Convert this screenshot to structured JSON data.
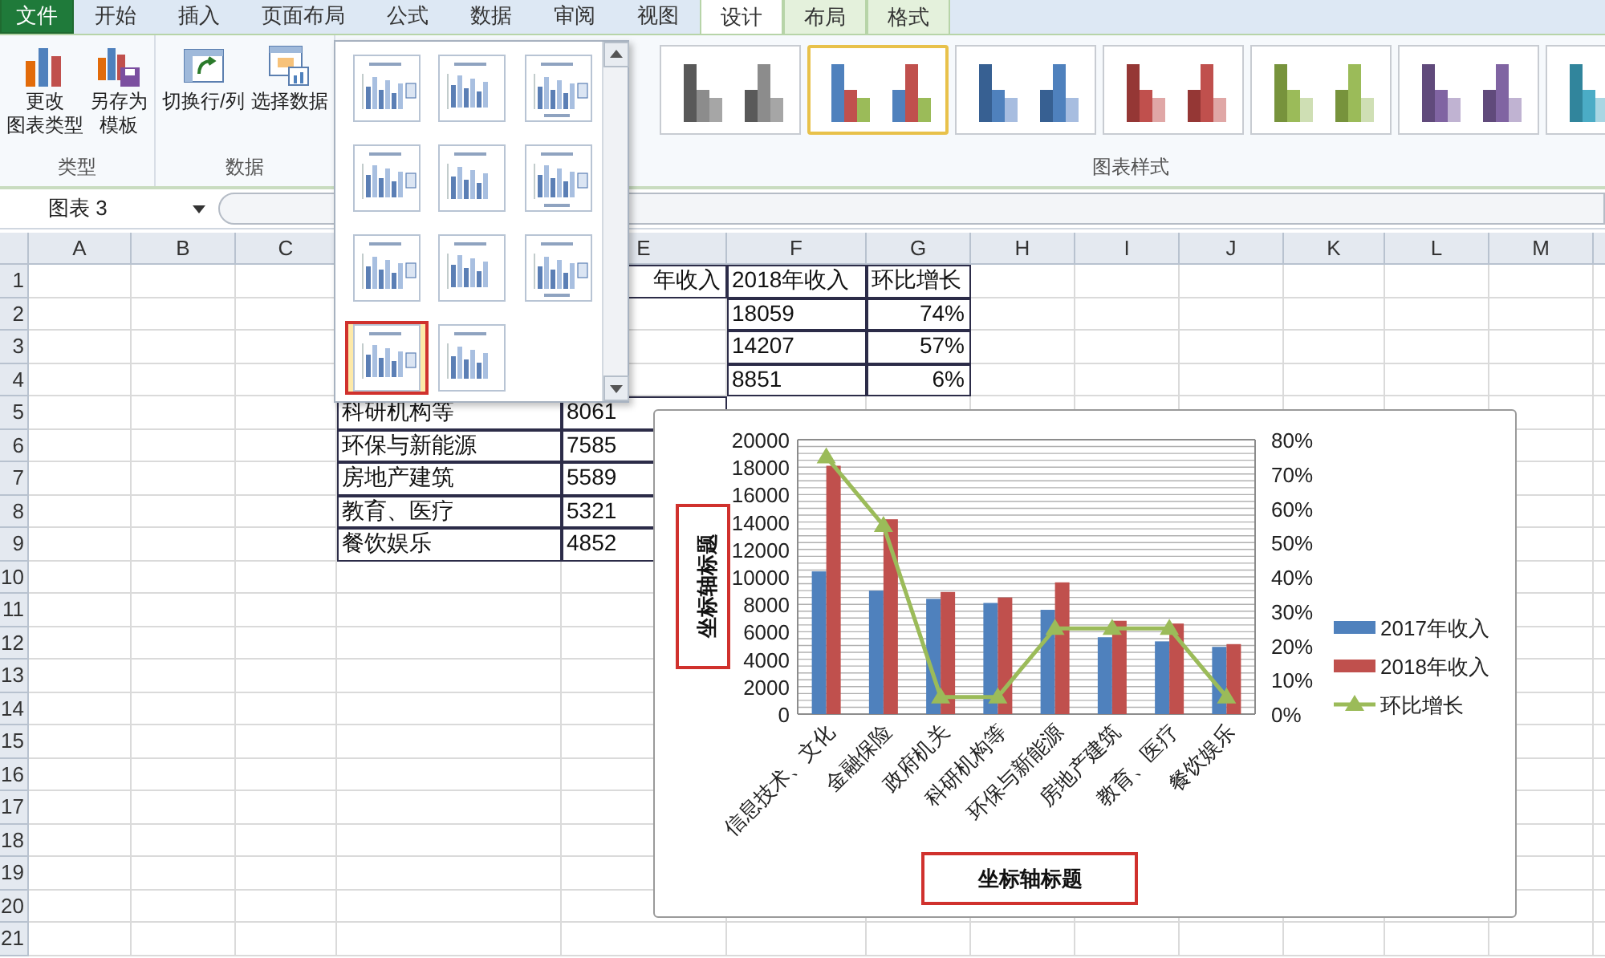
{
  "ribbon_tabs": [
    {
      "label": "文件",
      "kind": "file",
      "selected": false
    },
    {
      "label": "开始",
      "kind": "normal",
      "selected": false
    },
    {
      "label": "插入",
      "kind": "normal",
      "selected": false
    },
    {
      "label": "页面布局",
      "kind": "normal",
      "selected": false
    },
    {
      "label": "公式",
      "kind": "normal",
      "selected": false
    },
    {
      "label": "数据",
      "kind": "normal",
      "selected": false
    },
    {
      "label": "审阅",
      "kind": "normal",
      "selected": false
    },
    {
      "label": "视图",
      "kind": "normal",
      "selected": false
    },
    {
      "label": "设计",
      "kind": "contextual",
      "selected": true
    },
    {
      "label": "布局",
      "kind": "contextual",
      "selected": false
    },
    {
      "label": "格式",
      "kind": "contextual",
      "selected": false
    }
  ],
  "ribbon_groups": [
    {
      "label": "类型",
      "buttons": [
        {
          "lines": [
            "更改",
            "图表类型"
          ]
        },
        {
          "lines": [
            "另存为",
            "模板"
          ]
        }
      ]
    },
    {
      "label": "数据",
      "buttons": [
        {
          "lines": [
            "切换行/列"
          ]
        },
        {
          "lines": [
            "选择数据"
          ]
        }
      ]
    }
  ],
  "chart_styles": {
    "label": "图表样式",
    "items": [
      {
        "selected": false
      },
      {
        "selected": true
      },
      {
        "selected": false
      },
      {
        "selected": false
      },
      {
        "selected": false
      },
      {
        "selected": false
      },
      {
        "selected": false
      }
    ]
  },
  "layout_gallery": [
    {
      "selected": false,
      "highlighted": false
    },
    {
      "selected": false,
      "highlighted": false
    },
    {
      "selected": false,
      "highlighted": false
    },
    {
      "selected": false,
      "highlighted": false
    },
    {
      "selected": false,
      "highlighted": false
    },
    {
      "selected": false,
      "highlighted": false
    },
    {
      "selected": false,
      "highlighted": false
    },
    {
      "selected": false,
      "highlighted": false
    },
    {
      "selected": false,
      "highlighted": false
    },
    {
      "selected": true,
      "highlighted": true
    },
    {
      "selected": false,
      "highlighted": false
    }
  ],
  "name_box": "图表 3",
  "columns": [
    "A",
    "B",
    "C",
    null,
    "E",
    "F",
    "G",
    "H",
    "I",
    "J",
    "K",
    "L",
    "M"
  ],
  "rows": [
    {
      "header": "1",
      "cells": [
        null,
        null,
        null,
        null,
        {
          "text": "年收入",
          "right_aligned": true
        },
        "2018年收入",
        "环比增长"
      ]
    },
    {
      "header": "2",
      "cells": [
        null,
        null,
        null,
        null,
        null,
        "18059",
        {
          "text": "74%",
          "right_aligned": true
        }
      ]
    },
    {
      "header": "3",
      "cells": [
        null,
        null,
        null,
        null,
        null,
        "14207",
        {
          "text": "57%",
          "right_aligned": true
        }
      ]
    },
    {
      "header": "4",
      "cells": [
        null,
        null,
        null,
        null,
        null,
        "8851",
        {
          "text": "6%",
          "right_aligned": true
        }
      ]
    },
    {
      "header": "5",
      "cells": [
        null,
        null,
        null,
        "科研机构等",
        "8061"
      ]
    },
    {
      "header": "6",
      "cells": [
        null,
        null,
        null,
        "环保与新能源",
        "7585"
      ]
    },
    {
      "header": "7",
      "cells": [
        null,
        null,
        null,
        "房地产建筑",
        "5589"
      ]
    },
    {
      "header": "8",
      "cells": [
        null,
        null,
        null,
        "教育、医疗",
        "5321"
      ]
    },
    {
      "header": "9",
      "cells": [
        null,
        null,
        null,
        "餐饮娱乐",
        "4852"
      ]
    },
    {
      "header": "10",
      "cells": []
    },
    {
      "header": "11",
      "cells": []
    },
    {
      "header": "12",
      "cells": []
    },
    {
      "header": "13",
      "cells": []
    },
    {
      "header": "14",
      "cells": []
    },
    {
      "header": "15",
      "cells": []
    },
    {
      "header": "16",
      "cells": []
    },
    {
      "header": "17",
      "cells": []
    },
    {
      "header": "18",
      "cells": []
    },
    {
      "header": "19",
      "cells": []
    },
    {
      "header": "20",
      "cells": []
    },
    {
      "header": "21",
      "cells": []
    }
  ],
  "chart": {
    "ylabel_framed": true,
    "xlabel_framed": true,
    "chart_data": {
      "type": "bar",
      "xlabel": "坐标轴标题",
      "ylabel": "坐标轴标题",
      "categories": [
        "信息技术、文化",
        "金融保险",
        "政府机关",
        "科研机构等",
        "环保与新能源",
        "房地产建筑",
        "教育、医疗",
        "餐饮娱乐"
      ],
      "series": [
        {
          "name": "2017年收入",
          "color": "#4f81bd",
          "type": "bar",
          "values": [
            10400,
            9000,
            8400,
            8100,
            7600,
            5600,
            5300,
            4900
          ]
        },
        {
          "name": "2018年收入",
          "color": "#c0504d",
          "type": "bar",
          "values": [
            18100,
            14200,
            8900,
            8500,
            9600,
            6800,
            6600,
            5100
          ]
        },
        {
          "name": "环比增长",
          "color": "#9bbb59",
          "type": "line",
          "axis": "y2",
          "marker": "triangle",
          "values": [
            0.75,
            0.55,
            0.05,
            0.05,
            0.25,
            0.25,
            0.25,
            0.05
          ]
        }
      ],
      "grid": true,
      "legend": true,
      "ylim": [
        0,
        20000
      ],
      "yticks": [
        0,
        2000,
        4000,
        6000,
        8000,
        10000,
        12000,
        14000,
        16000,
        18000,
        20000
      ],
      "y2lim": [
        0,
        0.8
      ],
      "y2ticks": [
        {
          "value": 0,
          "label": "0%"
        },
        {
          "value": 0.1,
          "label": "10%"
        },
        {
          "value": 0.2,
          "label": "20%"
        },
        {
          "value": 0.3,
          "label": "30%"
        },
        {
          "value": 0.4,
          "label": "40%"
        },
        {
          "value": 0.5,
          "label": "50%"
        },
        {
          "value": 0.6,
          "label": "60%"
        },
        {
          "value": 0.7,
          "label": "70%"
        },
        {
          "value": 0.8,
          "label": "80%"
        }
      ]
    }
  }
}
